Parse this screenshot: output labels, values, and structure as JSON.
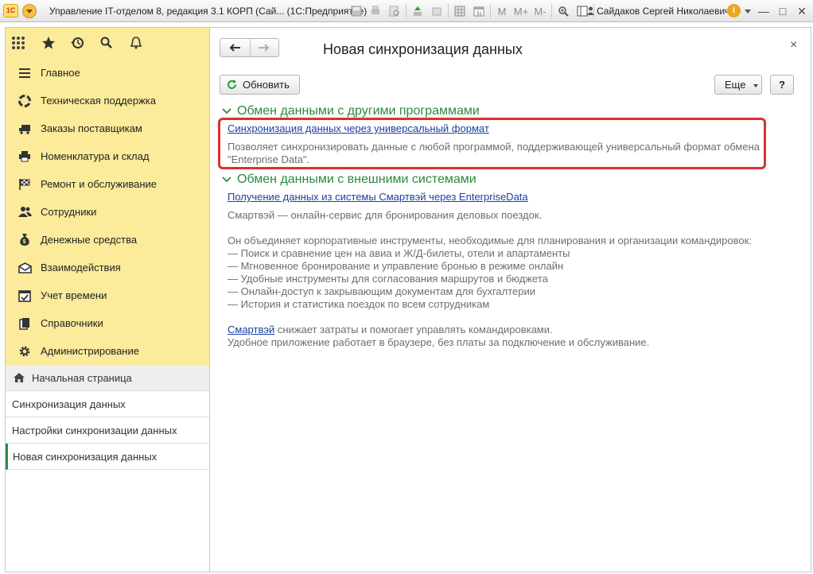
{
  "titlebar": {
    "logo_text": "1С",
    "title": "Управление IT-отделом 8, редакция 3.1 КОРП (Сай... (1С:Предприятие)",
    "user": "Сайдаков Сергей Николаевич",
    "info_label": "i",
    "memory_buttons": [
      "M",
      "M+",
      "M-"
    ],
    "window_controls": [
      "—",
      "□",
      "✕"
    ]
  },
  "quickbar": {
    "icons": [
      "apps-grid-icon",
      "favorites-star-icon",
      "history-icon",
      "search-icon",
      "notifications-bell-icon"
    ]
  },
  "sidebar": {
    "sections": [
      {
        "label": "Главное",
        "icon": "menu-lines-icon"
      },
      {
        "label": "Техническая поддержка",
        "icon": "lifebuoy-icon"
      },
      {
        "label": "Заказы поставщикам",
        "icon": "truck-icon"
      },
      {
        "label": "Номенклатура и склад",
        "icon": "printer-icon"
      },
      {
        "label": "Ремонт и обслуживание",
        "icon": "checkered-flag-icon"
      },
      {
        "label": "Сотрудники",
        "icon": "people-icon"
      },
      {
        "label": "Денежные средства",
        "icon": "money-bag-icon"
      },
      {
        "label": "Взаимодействия",
        "icon": "envelope-icon"
      },
      {
        "label": "Учет времени",
        "icon": "calendar-check-icon"
      },
      {
        "label": "Справочники",
        "icon": "books-icon"
      },
      {
        "label": "Администрирование",
        "icon": "gear-icon"
      }
    ],
    "open_windows": [
      {
        "label": "Начальная страница"
      },
      {
        "label": "Синхронизация данных"
      },
      {
        "label": "Настройки синхронизации данных"
      },
      {
        "label": "Новая синхронизация данных"
      }
    ]
  },
  "form": {
    "title": "Новая синхронизация данных",
    "close_label": "×",
    "refresh_label": "Обновить",
    "more_label": "Еще",
    "help_label": "?",
    "groups": [
      {
        "title": "Обмен данными с другими программами",
        "link": "Синхронизация данных через универсальный формат",
        "description": [
          "Позволяет синхронизировать данные с любой программой, поддерживающей универсальный формат обмена",
          "\"Enterprise Data\"."
        ]
      },
      {
        "title": "Обмен данными с внешними системами",
        "link": "Получение данных из системы Смартвэй через EnterpriseData",
        "description": [
          "Смартвэй — онлайн-сервис для бронирования деловых поездок.",
          "Он объединяет корпоративные инструменты, необходимые для планирования и организации командировок:",
          "— Поиск и сравнение цен на авиа и Ж/Д-билеты, отели и апартаменты",
          "— Мгновенное бронирование и управление бронью в режиме онлайн",
          "— Удобные инструменты для согласования маршрутов и бюджета",
          "— Онлайн-доступ к закрывающим документам для бухгалтерии",
          "— История и статистика поездок по всем сотрудникам"
        ],
        "footer_link": "Смартвэй",
        "footer_text": " снижает затраты и помогает управлять командировками.",
        "footer_line2": "Удобное приложение работает в браузере, без платы за подключение и обслуживание."
      }
    ]
  },
  "colors": {
    "sidebar_bg": "#fbeb9a",
    "group_title": "#2a8b3c",
    "link": "#1b3fa0",
    "highlight": "#d9322c",
    "active_marker": "#2f8a44"
  }
}
